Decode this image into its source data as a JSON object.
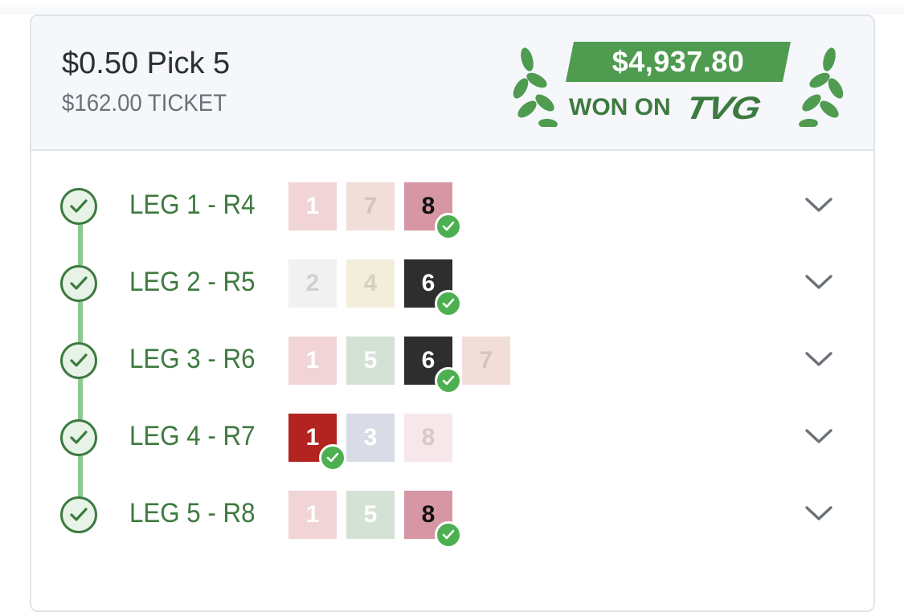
{
  "ticket": {
    "title": "$0.50 Pick 5",
    "amount": "$162.00 TICKET"
  },
  "win": {
    "amount": "$4,937.80",
    "won_on": "WON ON",
    "brand": "TVG",
    "accent_color": "#4f9b4f"
  },
  "legs": [
    {
      "label": "LEG 1 - R4",
      "status": "won",
      "selections": [
        {
          "number": "1",
          "bg": "#f1d4d6",
          "fg": "#ffffff",
          "winner": false
        },
        {
          "number": "7",
          "bg": "#f2ded9",
          "fg": "#d9c1bd",
          "winner": false
        },
        {
          "number": "8",
          "bg": "#d696a4",
          "fg": "#111111",
          "winner": true
        }
      ]
    },
    {
      "label": "LEG 2 - R5",
      "status": "won",
      "selections": [
        {
          "number": "2",
          "bg": "#f1f1f1",
          "fg": "#cfcfcf",
          "winner": false
        },
        {
          "number": "4",
          "bg": "#f2eedb",
          "fg": "#d6d1bc",
          "winner": false
        },
        {
          "number": "6",
          "bg": "#2e2e2e",
          "fg": "#ffffff",
          "winner": true
        }
      ]
    },
    {
      "label": "LEG 3 - R6",
      "status": "won",
      "selections": [
        {
          "number": "1",
          "bg": "#f1d4d6",
          "fg": "#ffffff",
          "winner": false
        },
        {
          "number": "5",
          "bg": "#d3e2d4",
          "fg": "#ffffff",
          "winner": false
        },
        {
          "number": "6",
          "bg": "#2e2e2e",
          "fg": "#ffffff",
          "winner": true
        },
        {
          "number": "7",
          "bg": "#f2ded9",
          "fg": "#d9c1bd",
          "winner": false
        }
      ]
    },
    {
      "label": "LEG 4 - R7",
      "status": "won",
      "selections": [
        {
          "number": "1",
          "bg": "#b3231f",
          "fg": "#ffffff",
          "winner": true
        },
        {
          "number": "3",
          "bg": "#d9dce6",
          "fg": "#ffffff",
          "winner": false
        },
        {
          "number": "8",
          "bg": "#f6e7ea",
          "fg": "#d8c6ca",
          "winner": false
        }
      ]
    },
    {
      "label": "LEG 5 - R8",
      "status": "won",
      "selections": [
        {
          "number": "1",
          "bg": "#f1d4d6",
          "fg": "#ffffff",
          "winner": false
        },
        {
          "number": "5",
          "bg": "#d3e2d4",
          "fg": "#ffffff",
          "winner": false
        },
        {
          "number": "8",
          "bg": "#d696a4",
          "fg": "#111111",
          "winner": true
        }
      ]
    }
  ],
  "icons": {
    "leg_status": "check-circle-icon",
    "winner": "check-badge-icon",
    "expand": "chevron-down-icon",
    "laurel": "laurel-icon"
  }
}
